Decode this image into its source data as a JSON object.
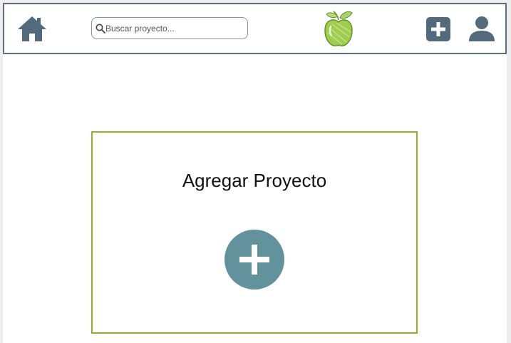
{
  "header": {
    "home_icon": "home-icon",
    "search": {
      "icon": "search-icon",
      "placeholder": "Buscar proyecto...",
      "value": ""
    },
    "logo_icon": "green-apple-logo",
    "add_icon": "plus-square-icon",
    "user_icon": "user-icon"
  },
  "main": {
    "card": {
      "title": "Agregar Proyecto",
      "add_icon": "plus-circle-icon"
    }
  },
  "colors": {
    "header_border": "#5d6f80",
    "icon": "#536a7d",
    "card_border": "#9aab3a",
    "add_circle": "#62929c",
    "apple_green": "#8dc63f"
  }
}
